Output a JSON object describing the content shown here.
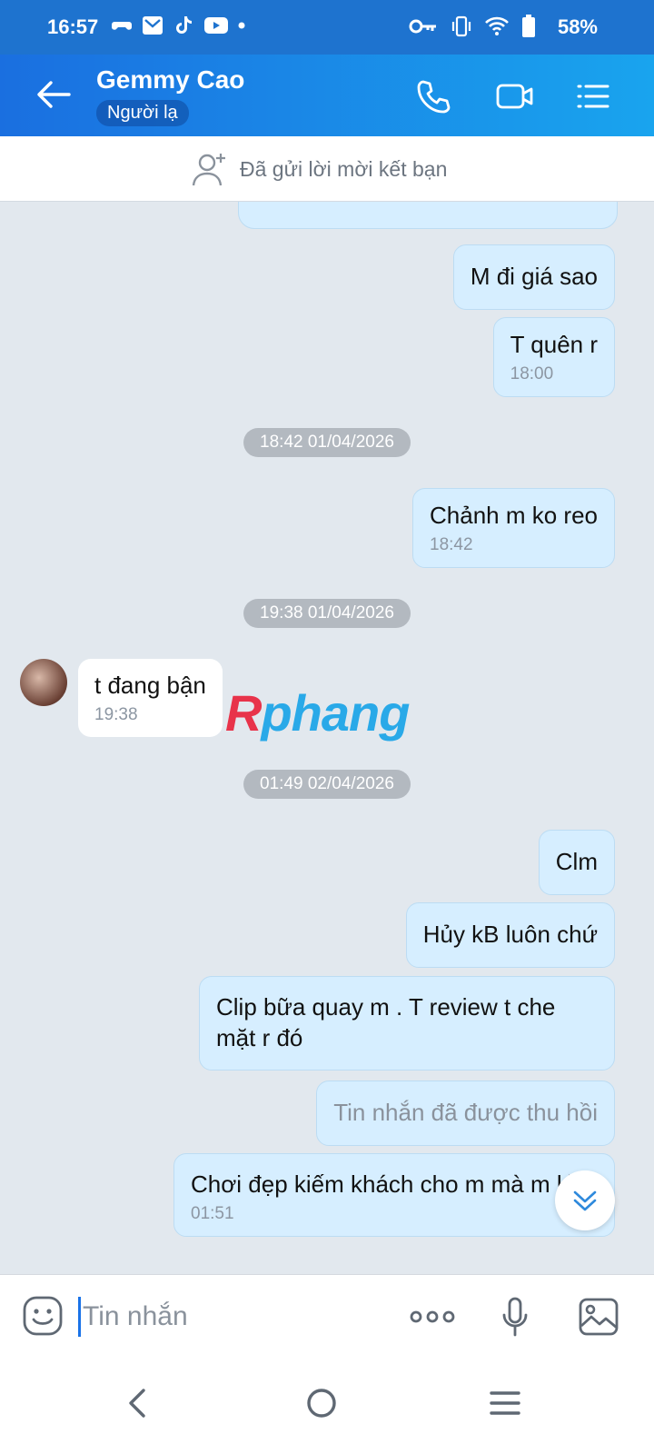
{
  "status_bar": {
    "time": "16:57",
    "battery": "58%"
  },
  "header": {
    "contact_name": "Gemmy Cao",
    "badge": "Người lạ"
  },
  "friend_request": {
    "text": "Đã gửi lời mời kết bạn"
  },
  "messages": [
    {
      "text": "M đi giá sao"
    },
    {
      "text": "T quên r",
      "time": "18:00"
    },
    {
      "date": "18:42 01/04/2026"
    },
    {
      "text": "Chảnh m ko reo",
      "time": "18:42"
    },
    {
      "date": "19:38 01/04/2026"
    },
    {
      "text": "t đang bận",
      "time": "19:38"
    },
    {
      "date": "01:49 02/04/2026"
    },
    {
      "text": "Clm"
    },
    {
      "text": "Hủy kB luôn chứ"
    },
    {
      "text": "Clip bữa quay m . T review t che mặt r đó"
    },
    {
      "text": "Tin nhắn đã được thu hồi"
    },
    {
      "text": "Chơi đẹp kiếm khách cho m mà m kì v",
      "time": "01:51"
    }
  ],
  "watermark": {
    "first": "R",
    "rest": "phang"
  },
  "composer": {
    "placeholder": "Tin nhắn"
  }
}
